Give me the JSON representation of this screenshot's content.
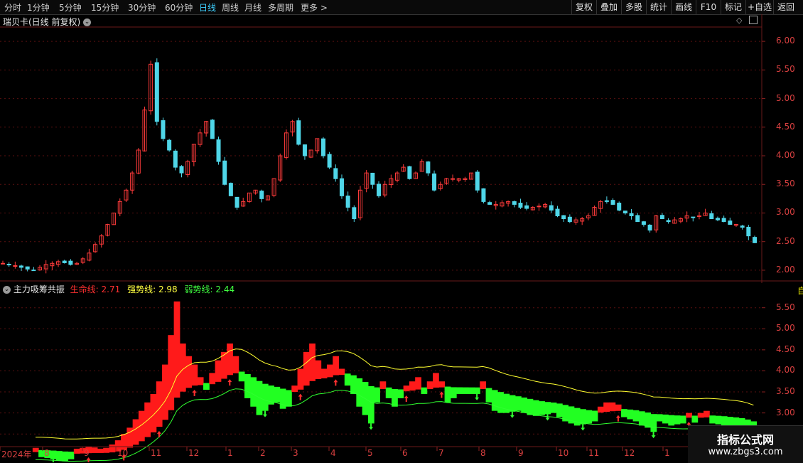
{
  "toolbar": {
    "periods": [
      "分时",
      "1分钟",
      "5分钟",
      "15分钟",
      "30分钟",
      "60分钟",
      "日线",
      "周线",
      "月线",
      "多周期",
      "更多 >"
    ],
    "active_index": 6,
    "right_buttons": [
      "复权",
      "叠加",
      "多股",
      "统计",
      "画线",
      "F10",
      "标记",
      "+自选",
      "返回"
    ]
  },
  "main_chart": {
    "title": "瑞贝卡(日线 前复权)",
    "y_ticks": [
      "6.00",
      "5.50",
      "5.00",
      "4.50",
      "4.00",
      "3.50",
      "3.00",
      "2.50",
      "2.00"
    ]
  },
  "indicator": {
    "name": "主力吸筹共振",
    "lines": [
      {
        "label": "生命线:",
        "value": "2.71",
        "color": "#ff3030"
      },
      {
        "label": "强势线:",
        "value": "2.98",
        "color": "#ffff40"
      },
      {
        "label": "弱势线:",
        "value": "2.44",
        "color": "#40ff40"
      }
    ],
    "y_ticks": [
      "5.50",
      "5.00",
      "4.50",
      "4.00",
      "3.50",
      "3.00",
      "2.50"
    ]
  },
  "x_axis": [
    "2024年",
    "8",
    "9",
    "10",
    "11",
    "12",
    "1",
    "2",
    "3",
    "4",
    "5",
    "6",
    "7",
    "8",
    "9",
    "10",
    "11",
    "12",
    "1"
  ],
  "watermark": {
    "line1": "指标公式网",
    "line2": "www.zbgs3.com"
  },
  "chart_data": {
    "type": "candlestick",
    "title": "瑞贝卡(日线 前复权)",
    "ylim": [
      1.85,
      6.25
    ],
    "close_series": [
      2.12,
      2.1,
      2.08,
      2.05,
      2.02,
      2.0,
      2.05,
      2.1,
      2.12,
      2.15,
      2.13,
      2.1,
      2.12,
      2.2,
      2.3,
      2.45,
      2.6,
      2.8,
      3.0,
      3.2,
      3.4,
      3.7,
      4.1,
      4.8,
      5.6,
      4.6,
      4.3,
      4.1,
      3.8,
      3.7,
      3.9,
      4.2,
      4.4,
      4.6,
      4.3,
      3.9,
      3.5,
      3.3,
      3.1,
      3.2,
      3.35,
      3.4,
      3.25,
      3.3,
      3.6,
      4.0,
      4.4,
      4.6,
      4.2,
      4.0,
      4.1,
      4.3,
      4.0,
      3.8,
      3.6,
      3.3,
      3.1,
      2.9,
      3.4,
      3.7,
      3.5,
      3.3,
      3.5,
      3.6,
      3.7,
      3.8,
      3.6,
      3.7,
      3.9,
      3.7,
      3.4,
      3.5,
      3.6,
      3.6,
      3.6,
      3.6,
      3.7,
      3.4,
      3.2,
      3.15,
      3.15,
      3.18,
      3.2,
      3.15,
      3.1,
      3.08,
      3.1,
      3.12,
      3.15,
      3.05,
      2.95,
      2.9,
      2.85,
      2.88,
      2.9,
      2.95,
      3.1,
      3.2,
      3.2,
      3.15,
      3.05,
      3.0,
      2.95,
      2.85,
      2.8,
      2.7,
      2.95,
      2.9,
      2.85,
      2.88,
      2.9,
      2.95,
      2.92,
      2.95,
      3.0,
      2.9,
      2.88,
      2.85,
      2.8,
      2.8,
      2.75,
      2.6,
      2.48
    ]
  }
}
